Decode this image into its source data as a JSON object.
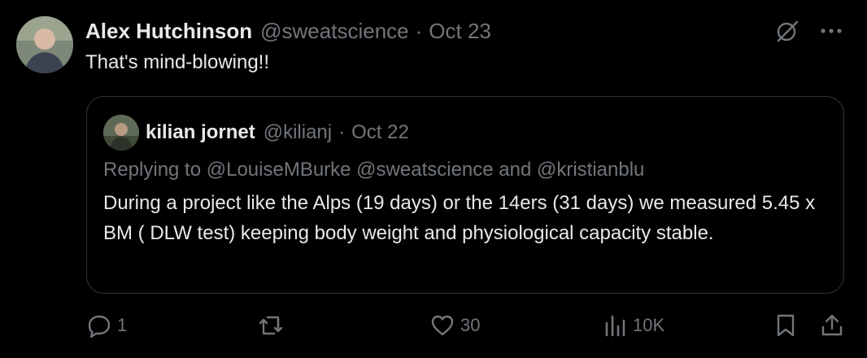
{
  "tweet": {
    "author_name": "Alex Hutchinson",
    "author_handle": "@sweatscience",
    "separator": "·",
    "date": "Oct 23",
    "text": "That's mind-blowing!!"
  },
  "quoted_tweet": {
    "author_name": "kilian jornet",
    "author_handle": "@kilianj",
    "separator": "·",
    "date": "Oct 22",
    "replying_to": "Replying to @LouiseMBurke @sweatscience and @kristianblu",
    "text": "During a project like the Alps (19 days) or the 14ers (31 days) we measured 5.45 x BM ( DLW test) keeping body weight and physiological capacity stable."
  },
  "actions": {
    "replies": "1",
    "reposts": "",
    "likes": "30",
    "views": "10K"
  },
  "icons": {
    "top": [
      "grok-icon",
      "more-icon"
    ],
    "bottom": [
      "reply-icon",
      "repost-icon",
      "like-icon",
      "views-icon",
      "bookmark-icon",
      "share-icon"
    ]
  },
  "colors": {
    "background": "#000000",
    "primary_text": "#e7e9ea",
    "secondary_text": "#71767b",
    "border": "#333639"
  }
}
